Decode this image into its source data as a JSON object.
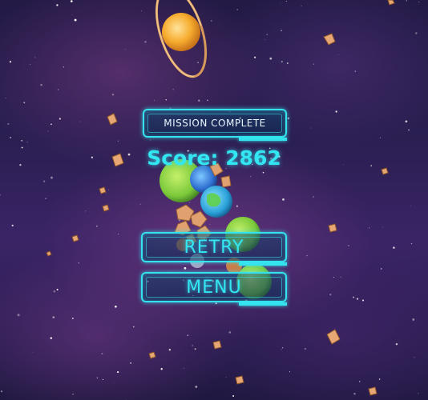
{
  "hud": {
    "mission_status": "MISSION COMPLETE",
    "score_label": "Score: 2862"
  },
  "buttons": {
    "retry": "RETRY",
    "menu": "MENU"
  },
  "colors": {
    "accent_cyan": "#34e3ee",
    "space_background": "#2b1f52",
    "ringed_planet": "#f4a62a",
    "asteroid": "#e0a070"
  },
  "icons": [
    "ringed-planet-icon",
    "green-planet-icon",
    "blue-planet-icon",
    "earth-planet-icon",
    "asteroid-icon"
  ]
}
